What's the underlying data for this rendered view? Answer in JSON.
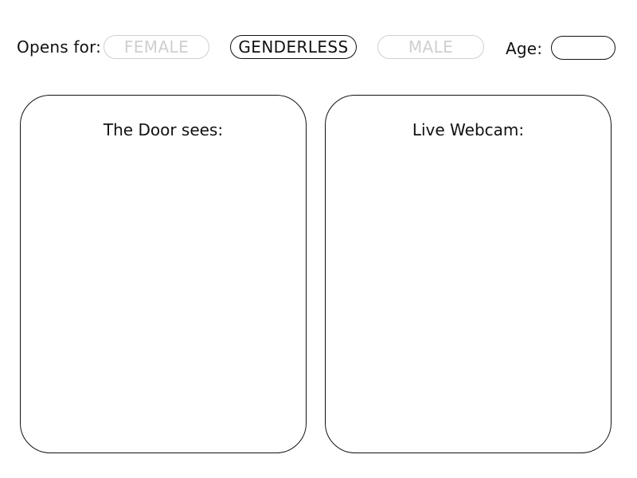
{
  "filter_bar": {
    "opens_for_label": "Opens for:",
    "options": [
      {
        "label": "FEMALE",
        "state": "inactive"
      },
      {
        "label": "GENDERLESS",
        "state": "active"
      },
      {
        "label": "MALE",
        "state": "inactive"
      }
    ],
    "age_label": "Age:",
    "age_value": ""
  },
  "panels": {
    "door_view": {
      "title": "The Door sees:"
    },
    "webcam": {
      "title": "Live Webcam:"
    }
  },
  "colors": {
    "active_border": "#111111",
    "inactive": "#cfcfcf",
    "background": "#ffffff"
  }
}
